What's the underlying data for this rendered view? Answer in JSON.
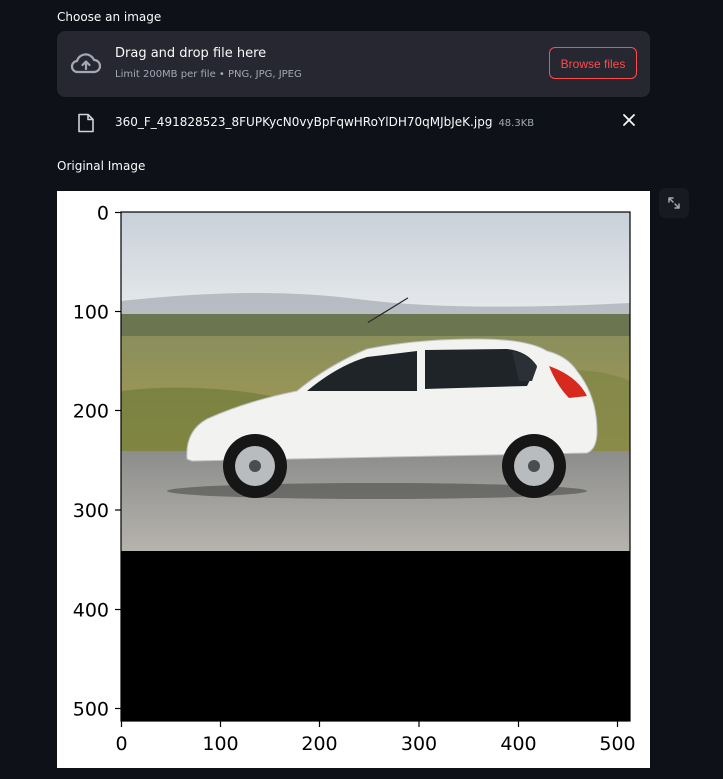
{
  "uploader": {
    "label": "Choose an image",
    "drop_title": "Drag and drop file here",
    "drop_hint": "Limit 200MB per file • PNG, JPG, JPEG",
    "browse_label": "Browse files",
    "file_name": "360_F_491828523_8FUPKycN0vyBpFqwHRoYlDH70qMJbJeK.jpg",
    "file_size": "48.3KB"
  },
  "image_section": {
    "label": "Original Image"
  },
  "plot": {
    "x_ticks": [
      "0",
      "100",
      "200",
      "300",
      "400",
      "500"
    ],
    "y_ticks": [
      "0",
      "100",
      "200",
      "300",
      "400",
      "500"
    ]
  },
  "colors": {
    "background": "#0e1117",
    "surface": "#262730",
    "accent": "#ff4b4b"
  },
  "icons": [
    "cloud-upload-icon",
    "file-icon",
    "close-icon",
    "expand-icon"
  ]
}
